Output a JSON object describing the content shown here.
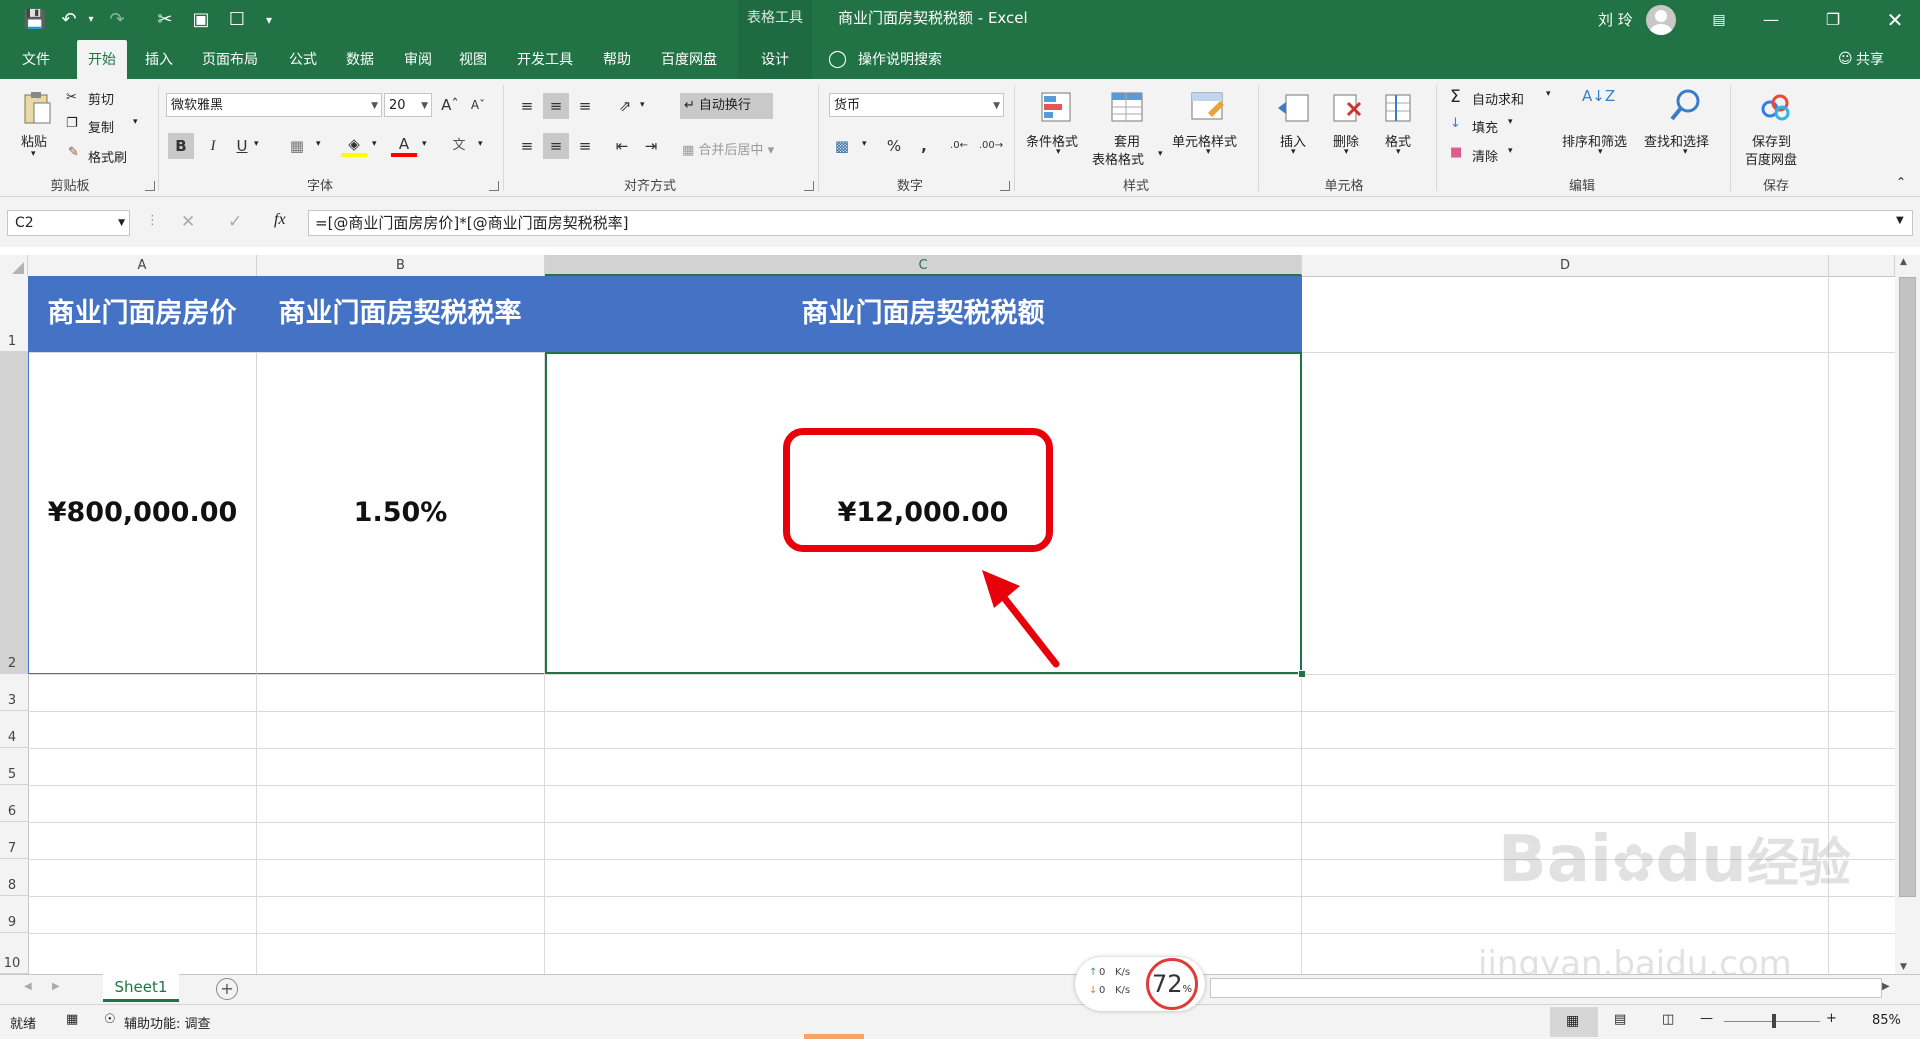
{
  "app": {
    "window_title": "商业门面房契税税额  -  Excel",
    "table_tools": "表格工具",
    "user_name": "刘 玲",
    "quick_access": [
      "save-icon",
      "undo-icon",
      "redo-icon",
      "cut-icon",
      "save-as-icon",
      "new-icon",
      "customize-icon"
    ]
  },
  "ribbon_tabs": [
    "文件",
    "开始",
    "插入",
    "页面布局",
    "公式",
    "数据",
    "审阅",
    "视图",
    "开发工具",
    "帮助",
    "百度网盘",
    "设计"
  ],
  "active_tab": "开始",
  "search_label": "操作说明搜索",
  "share_label": "共享",
  "clipboard": {
    "paste": "粘贴",
    "cut": "剪切",
    "copy": "复制",
    "format_painter": "格式刷",
    "label": "剪贴板"
  },
  "font": {
    "name": "微软雅黑",
    "size": "20",
    "label": "字体",
    "bold": "B",
    "italic": "I",
    "underline": "U"
  },
  "alignment": {
    "wrap": "自动换行",
    "merge": "合并后居中",
    "label": "对齐方式"
  },
  "number": {
    "format": "货币",
    "label": "数字",
    "percent": "%",
    "comma": ","
  },
  "styles": {
    "conditional": "条件格式",
    "table_format_1": "套用",
    "table_format_2": "表格格式",
    "cell_styles": "单元格样式",
    "label": "样式"
  },
  "cells_group": {
    "insert": "插入",
    "delete": "删除",
    "format": "格式",
    "label": "单元格"
  },
  "editing": {
    "autosum": "自动求和",
    "fill": "填充",
    "clear": "清除",
    "sort": "排序和筛选",
    "find": "查找和选择",
    "label": "编辑"
  },
  "save_group": {
    "save_to_1": "保存到",
    "save_to_2": "百度网盘",
    "label": "保存"
  },
  "formula_bar": {
    "name_box": "C2",
    "formula": "=[@商业门面房房价]*[@商业门面房契税税率]",
    "fx": "fx"
  },
  "columns": [
    "A",
    "B",
    "C",
    "D"
  ],
  "rows": [
    "1",
    "2",
    "3",
    "4",
    "5",
    "6",
    "7",
    "8",
    "9",
    "10"
  ],
  "table": {
    "headers": [
      "商业门面房房价",
      "商业门面房契税税率",
      "商业门面房契税税额"
    ],
    "row": [
      "¥800,000.00",
      "1.50%",
      "¥12,000.00"
    ],
    "header_color": "#4472c4",
    "highlight_color": "#e8000b"
  },
  "sheet_tabs": [
    "Sheet1"
  ],
  "status": {
    "ready": "就绪",
    "accessibility": "辅助功能: 调查",
    "zoom": "85%"
  },
  "net_widget": {
    "up": "0",
    "down": "0",
    "unit": "K/s",
    "percent": "72",
    "percent_sign": "%"
  },
  "watermark": {
    "brand": "Bai",
    "brand2": "du",
    "jingyan": "经验",
    "url": "jingyan.baidu.com"
  }
}
